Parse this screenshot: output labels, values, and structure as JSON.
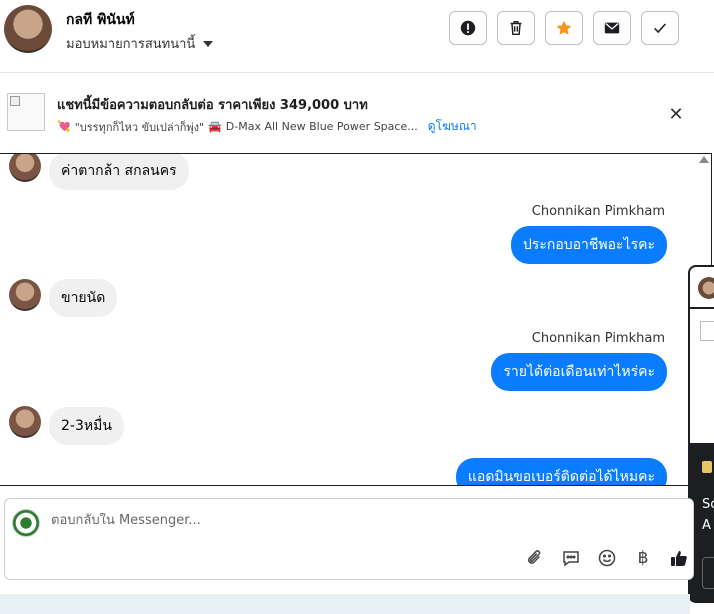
{
  "header": {
    "contact_name": "กลที พินันท์",
    "assign_label": "มอบหมายการสนทนานี้",
    "actions": [
      {
        "name": "report",
        "icon": "exclamation-circle-icon"
      },
      {
        "name": "delete",
        "icon": "trash-icon"
      },
      {
        "name": "star",
        "icon": "star-icon",
        "color": "#f7931e"
      },
      {
        "name": "mail",
        "icon": "mail-icon"
      },
      {
        "name": "done",
        "icon": "check-icon"
      }
    ]
  },
  "ad": {
    "title": "แชทนี้มีข้อความตอบกลับต่อ ราคาเพียง 349,000 บาท",
    "subtitle_emoji": "💘",
    "subtitle_quote": "\"บรรทุกก็ไหว ขับเปล่าก็พุ่ง\"",
    "subtitle_car_emoji": "🚘",
    "subtitle_text": "D-Max All New Blue Power Space...",
    "link": "ดูโฆษณา"
  },
  "messages": [
    {
      "type": "incoming",
      "text": "ค่าตากล้า สกลนคร"
    },
    {
      "type": "outgoing",
      "sender": "Chonnikan Pimkham",
      "text": "ประกอบอาชีพอะไรคะ"
    },
    {
      "type": "incoming",
      "text": "ขายนัด"
    },
    {
      "type": "outgoing",
      "sender": "Chonnikan Pimkham",
      "text": "รายได้ต่อเดือนเท่าไหร่คะ"
    },
    {
      "type": "incoming",
      "text": "2-3หมื่น"
    },
    {
      "type": "outgoing",
      "text": "แอดมินขอเบอร์ติดต่อได้ไหมคะ"
    }
  ],
  "composer": {
    "placeholder": "ตอบกลับใน Messenger...",
    "baht_symbol": "฿"
  },
  "side_panel": {
    "text_lines": [
      "Sc",
      "A"
    ]
  },
  "colors": {
    "accent": "#0a7cff",
    "incoming_bubble": "#f0f0f0"
  }
}
